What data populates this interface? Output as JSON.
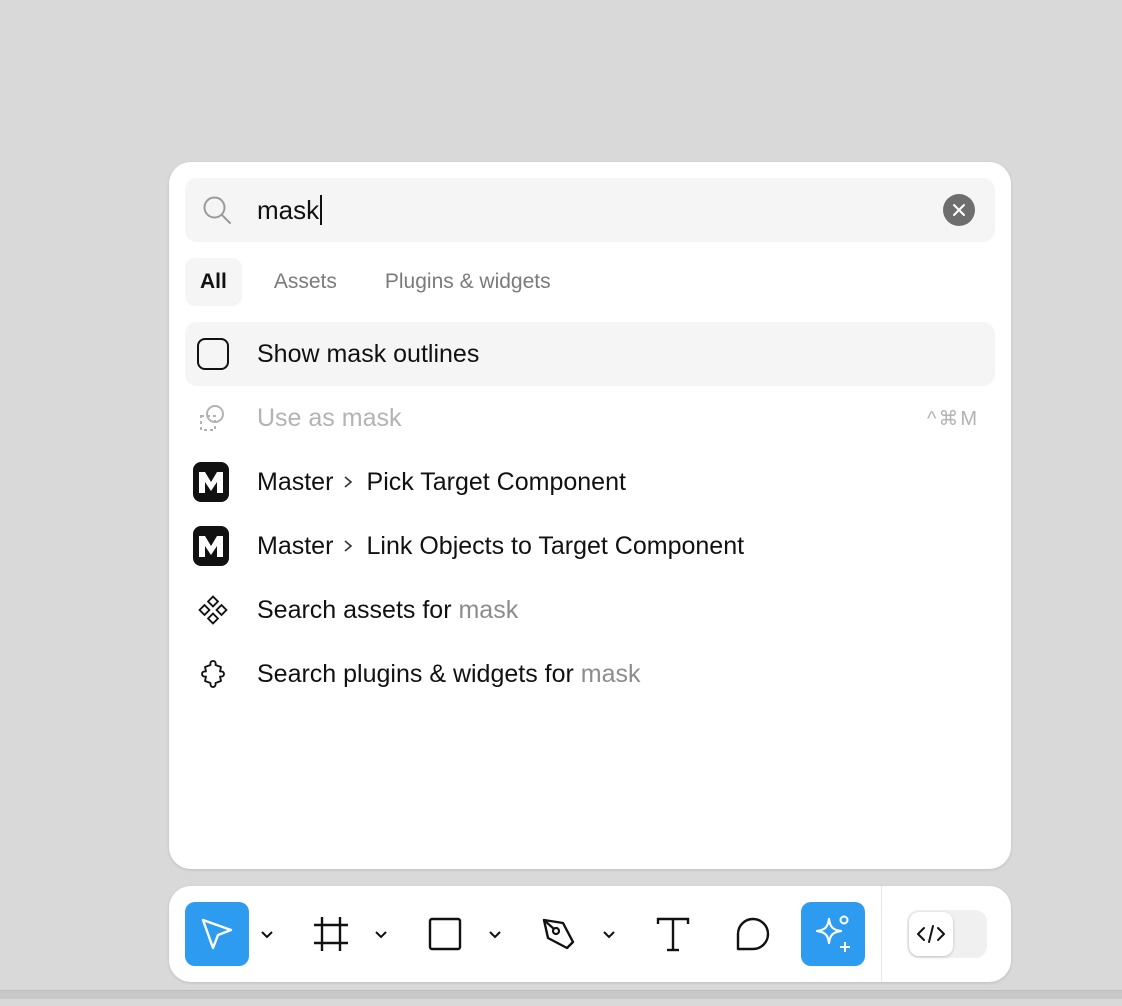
{
  "search": {
    "value": "mask",
    "clear_label": "Clear search"
  },
  "tabs": [
    {
      "label": "All",
      "active": true
    },
    {
      "label": "Assets",
      "active": false
    },
    {
      "label": "Plugins & widgets",
      "active": false
    }
  ],
  "results": [
    {
      "icon": "checkbox-icon",
      "label": "Show mask outlines",
      "selected": true
    },
    {
      "icon": "mask-icon",
      "label": "Use as mask",
      "disabled": true,
      "shortcut": "^⌘M"
    },
    {
      "icon": "master-plugin-icon",
      "plugin": "Master",
      "label": "Pick Target Component"
    },
    {
      "icon": "master-plugin-icon",
      "plugin": "Master",
      "label": "Link Objects to Target Component"
    },
    {
      "icon": "assets-icon",
      "prefix": "Search assets for ",
      "query": "mask"
    },
    {
      "icon": "plugin-icon",
      "prefix": "Search plugins & widgets for ",
      "query": "mask"
    }
  ],
  "toolbar": {
    "tools": [
      "move-tool",
      "frame-tool",
      "rectangle-tool",
      "pen-tool",
      "text-tool",
      "comment-tool",
      "ai-tool"
    ],
    "accent": "#2d9bf0"
  },
  "colors": {
    "background": "#d9d9d9",
    "panel": "#ffffff",
    "selected_row": "#f5f5f5",
    "accent": "#2d9bf0"
  }
}
